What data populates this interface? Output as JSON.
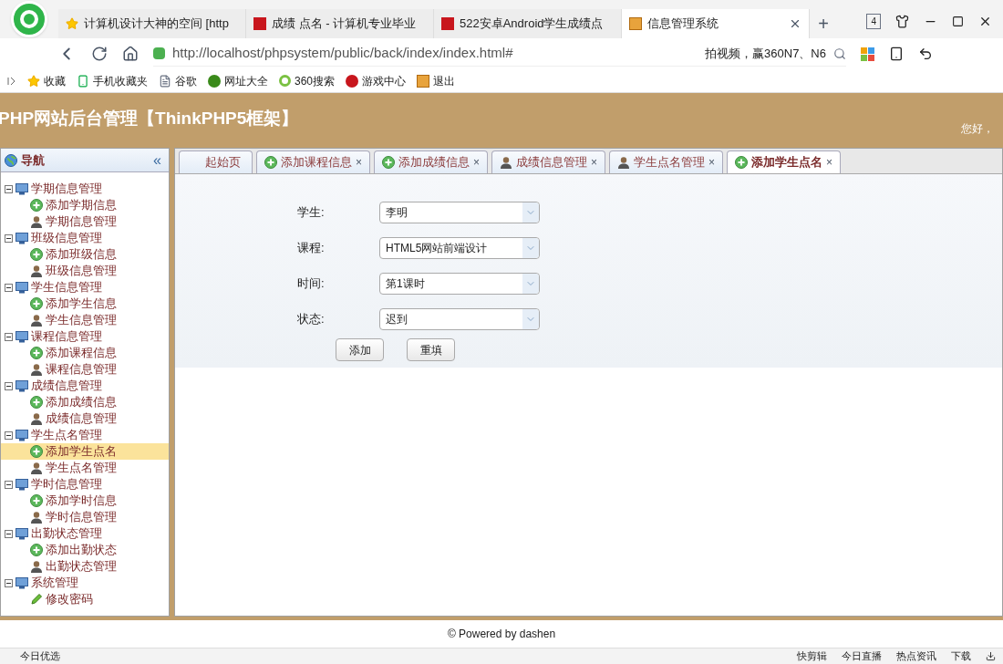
{
  "browser": {
    "tabs": [
      {
        "title": "计算机设计大神的空间 [http",
        "selected": false
      },
      {
        "title": "成绩 点名 - 计算机专业毕业",
        "selected": false
      },
      {
        "title": "522安卓Android学生成绩点",
        "selected": false
      },
      {
        "title": "信息管理系统",
        "selected": true
      }
    ],
    "new_tab": "+",
    "tab_count": "4",
    "address": "http://localhost/phpsystem/public/back/index/index.html#",
    "search_hint": "拍视频，赢360N7、N6",
    "bookmarks": [
      {
        "label": "收藏"
      },
      {
        "label": "手机收藏夹"
      },
      {
        "label": "谷歌"
      },
      {
        "label": "网址大全"
      },
      {
        "label": "360搜索"
      },
      {
        "label": "游戏中心"
      },
      {
        "label": "退出"
      }
    ]
  },
  "header": {
    "title": "PHP网站后台管理【ThinkPHP5框架】",
    "greeting": "您好，"
  },
  "nav": {
    "title": "导航",
    "collapse": "«",
    "tree": [
      {
        "label": "学期信息管理",
        "expanded": true,
        "children": [
          {
            "label": "添加学期信息",
            "kind": "add",
            "selected": false
          },
          {
            "label": "学期信息管理",
            "kind": "manage",
            "selected": false
          }
        ]
      },
      {
        "label": "班级信息管理",
        "expanded": true,
        "children": [
          {
            "label": "添加班级信息",
            "kind": "add",
            "selected": false
          },
          {
            "label": "班级信息管理",
            "kind": "manage",
            "selected": false
          }
        ]
      },
      {
        "label": "学生信息管理",
        "expanded": true,
        "children": [
          {
            "label": "添加学生信息",
            "kind": "add",
            "selected": false
          },
          {
            "label": "学生信息管理",
            "kind": "manage",
            "selected": false
          }
        ]
      },
      {
        "label": "课程信息管理",
        "expanded": true,
        "children": [
          {
            "label": "添加课程信息",
            "kind": "add",
            "selected": false
          },
          {
            "label": "课程信息管理",
            "kind": "manage",
            "selected": false
          }
        ]
      },
      {
        "label": "成绩信息管理",
        "expanded": true,
        "children": [
          {
            "label": "添加成绩信息",
            "kind": "add",
            "selected": false
          },
          {
            "label": "成绩信息管理",
            "kind": "manage",
            "selected": false
          }
        ]
      },
      {
        "label": "学生点名管理",
        "expanded": true,
        "children": [
          {
            "label": "添加学生点名",
            "kind": "add",
            "selected": true
          },
          {
            "label": "学生点名管理",
            "kind": "manage",
            "selected": false
          }
        ]
      },
      {
        "label": "学时信息管理",
        "expanded": true,
        "children": [
          {
            "label": "添加学时信息",
            "kind": "add",
            "selected": false
          },
          {
            "label": "学时信息管理",
            "kind": "manage",
            "selected": false
          }
        ]
      },
      {
        "label": "出勤状态管理",
        "expanded": true,
        "children": [
          {
            "label": "添加出勤状态",
            "kind": "add",
            "selected": false
          },
          {
            "label": "出勤状态管理",
            "kind": "manage",
            "selected": false
          }
        ]
      },
      {
        "label": "系统管理",
        "expanded": true,
        "children": [
          {
            "label": "修改密码",
            "kind": "edit",
            "selected": false
          }
        ]
      }
    ]
  },
  "page_tabs": [
    {
      "label": "起始页",
      "kind": "home",
      "selected": false
    },
    {
      "label": "添加课程信息",
      "kind": "add",
      "selected": false
    },
    {
      "label": "添加成绩信息",
      "kind": "add",
      "selected": false
    },
    {
      "label": "成绩信息管理",
      "kind": "manage",
      "selected": false
    },
    {
      "label": "学生点名管理",
      "kind": "manage",
      "selected": false
    },
    {
      "label": "添加学生点名",
      "kind": "add",
      "selected": true
    }
  ],
  "close_mark": "×",
  "form": {
    "fields": [
      {
        "label": "学生:",
        "value": "李明"
      },
      {
        "label": "课程:",
        "value": "HTML5网站前端设计"
      },
      {
        "label": "时间:",
        "value": "第1课时"
      },
      {
        "label": "状态:",
        "value": "迟到"
      }
    ],
    "buttons": [
      "添加",
      "重填"
    ]
  },
  "footer": "© Powered by dashen",
  "status_bar": {
    "left": "今日优选",
    "right": [
      "快剪辑",
      "今日直播",
      "热点资讯",
      "下载"
    ]
  }
}
